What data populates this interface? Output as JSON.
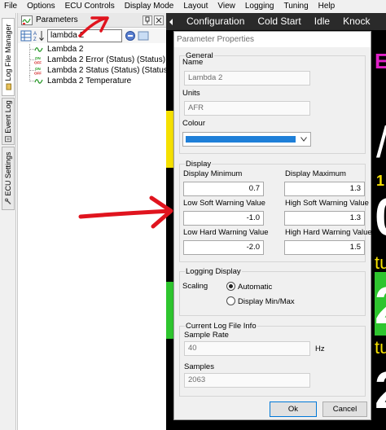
{
  "menu": [
    "File",
    "Options",
    "ECU Controls",
    "Display Mode",
    "Layout",
    "View",
    "Logging",
    "Tuning",
    "Help"
  ],
  "side_tabs": {
    "log_file_manager": "Log File Manager",
    "event_log": "Event Log",
    "ecu_settings": "ECU Settings"
  },
  "params_panel": {
    "title": "Parameters",
    "search_value": "lambda 2",
    "items": [
      {
        "label": "Lambda 2",
        "icon": "wave-icon"
      },
      {
        "label": "Lambda 2 Error (Status) (Status)",
        "icon": "on-off-icon"
      },
      {
        "label": "Lambda 2 Status (Status) (Status)",
        "icon": "on-off-icon"
      },
      {
        "label": "Lambda 2 Temperature",
        "icon": "wave-icon"
      }
    ]
  },
  "dashboard": {
    "tabs": [
      "Configuration",
      "Cold Start",
      "Idle",
      "Knock"
    ],
    "fragments": [
      "E",
      "/",
      "1",
      "0",
      "tu",
      "2",
      "tu",
      "2"
    ]
  },
  "dialog": {
    "title": "Parameter Properties",
    "general": {
      "title": "General",
      "name_label": "Name",
      "name_value": "Lambda 2",
      "units_label": "Units",
      "units_value": "AFR",
      "colour_label": "Colour",
      "colour_value": "#1e7fd8"
    },
    "display": {
      "title": "Display",
      "min_label": "Display Minimum",
      "min_value": "0.7",
      "max_label": "Display Maximum",
      "max_value": "1.3",
      "low_soft_label": "Low Soft Warning Value",
      "low_soft_value": "-1.0",
      "high_soft_label": "High Soft Warning Value",
      "high_soft_value": "1.3",
      "low_hard_label": "Low Hard Warning Value",
      "low_hard_value": "-2.0",
      "high_hard_label": "High Hard Warning Value",
      "high_hard_value": "1.5"
    },
    "logging": {
      "title": "Logging Display",
      "scaling_label": "Scaling",
      "option_auto": "Automatic",
      "option_minmax": "Display Min/Max",
      "selected": "Automatic"
    },
    "log_info": {
      "title": "Current Log File Info",
      "sample_rate_label": "Sample Rate",
      "sample_rate_value": "40",
      "sample_rate_unit": "Hz",
      "samples_label": "Samples",
      "samples_value": "2063"
    },
    "ok_label": "Ok",
    "cancel_label": "Cancel"
  },
  "colors": {
    "annotation": "#e0141e",
    "dash_yellow": "#f5e000",
    "dash_green": "#2ec52e",
    "dash_magenta": "#e020c8"
  }
}
